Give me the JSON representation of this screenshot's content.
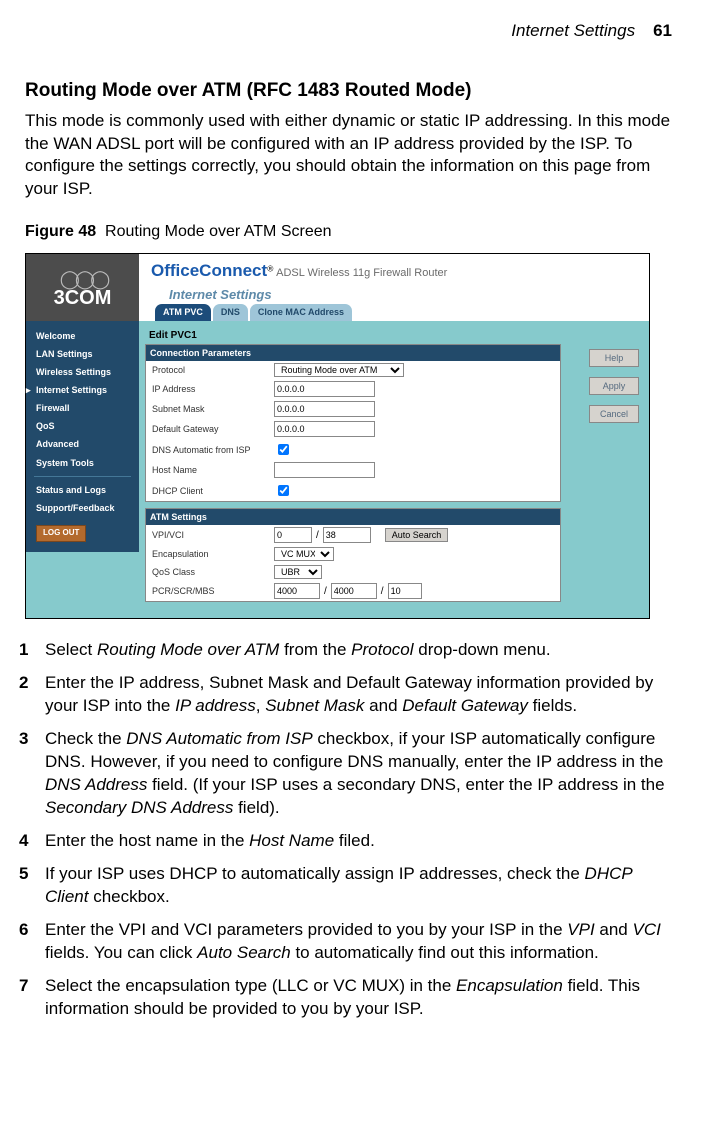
{
  "header": {
    "section": "Internet Settings",
    "page": "61"
  },
  "title": "Routing Mode over ATM (RFC 1483 Routed Mode)",
  "intro": "This mode is commonly used with either dynamic or static IP addressing. In this mode the WAN ADSL port will be configured with an IP address provided by the ISP. To configure the settings correctly, you should obtain the information on this page from your ISP.",
  "figure": {
    "label": "Figure 48",
    "caption": "Routing Mode over ATM Screen"
  },
  "screenshot": {
    "brand": "OfficeConnect",
    "brand_sub": "ADSL Wireless 11g Firewall Router",
    "logo": "3COM",
    "section_label": "Internet Settings",
    "tabs": [
      "ATM PVC",
      "DNS",
      "Clone MAC Address"
    ],
    "sidebar": [
      "Welcome",
      "LAN Settings",
      "Wireless Settings",
      "Internet Settings",
      "Firewall",
      "QoS",
      "Advanced",
      "System Tools"
    ],
    "sidebar_lower": [
      "Status and Logs",
      "Support/Feedback"
    ],
    "active_sidebar": "Internet Settings",
    "logout": "LOG OUT",
    "edit_title": "Edit PVC1",
    "panel1_title": "Connection Parameters",
    "fields": {
      "protocol_label": "Protocol",
      "protocol_value": "Routing Mode over ATM",
      "ip_label": "IP Address",
      "ip_value": "0.0.0.0",
      "subnet_label": "Subnet Mask",
      "subnet_value": "0.0.0.0",
      "gateway_label": "Default Gateway",
      "gateway_value": "0.0.0.0",
      "dnsauto_label": "DNS Automatic from ISP",
      "host_label": "Host Name",
      "host_value": "",
      "dhcp_label": "DHCP Client"
    },
    "panel2_title": "ATM Settings",
    "atm": {
      "vpivci_label": "VPI/VCI",
      "vpi_value": "0",
      "vci_value": "38",
      "autosearch": "Auto Search",
      "encap_label": "Encapsulation",
      "encap_value": "VC MUX",
      "qos_label": "QoS Class",
      "qos_value": "UBR",
      "pcr_label": "PCR/SCR/MBS",
      "pcr_value": "4000",
      "scr_value": "4000",
      "mbs_value": "10"
    },
    "buttons": {
      "help": "Help",
      "apply": "Apply",
      "cancel": "Cancel"
    }
  },
  "steps": {
    "s1a": "Select ",
    "s1b": "Routing Mode over ATM",
    "s1c": " from the ",
    "s1d": "Protocol",
    "s1e": " drop-down menu.",
    "s2a": "Enter the IP address, Subnet Mask and Default Gateway information provided by your ISP into the ",
    "s2b": "IP address",
    "s2c": ", ",
    "s2d": "Subnet Mask",
    "s2e": " and ",
    "s2f": "Default Gateway",
    "s2g": " fields.",
    "s3a": "Check the ",
    "s3b": "DNS Automatic from ISP",
    "s3c": " checkbox, if your ISP automatically configure DNS. However, if you need to configure DNS manually, enter the IP address in the ",
    "s3d": "DNS Address",
    "s3e": " field. (If your ISP uses a secondary DNS, enter the IP address in the ",
    "s3f": "Secondary DNS Address",
    "s3g": " field).",
    "s4a": "Enter the host name in the ",
    "s4b": "Host Name",
    "s4c": " filed.",
    "s5a": "If your ISP uses DHCP to automatically assign IP addresses, check the ",
    "s5b": "DHCP Client",
    "s5c": " checkbox.",
    "s6a": "Enter the VPI and VCI parameters provided to you by your ISP in the ",
    "s6b": "VPI",
    "s6c": " and ",
    "s6d": "VCI",
    "s6e": " fields. You can click ",
    "s6f": "Auto Search",
    "s6g": " to automatically find out this information.",
    "s7a": "Select the encapsulation type (LLC or VC MUX) in the ",
    "s7b": "Encapsulation",
    "s7c": " field. This information should be provided to you by your ISP."
  }
}
